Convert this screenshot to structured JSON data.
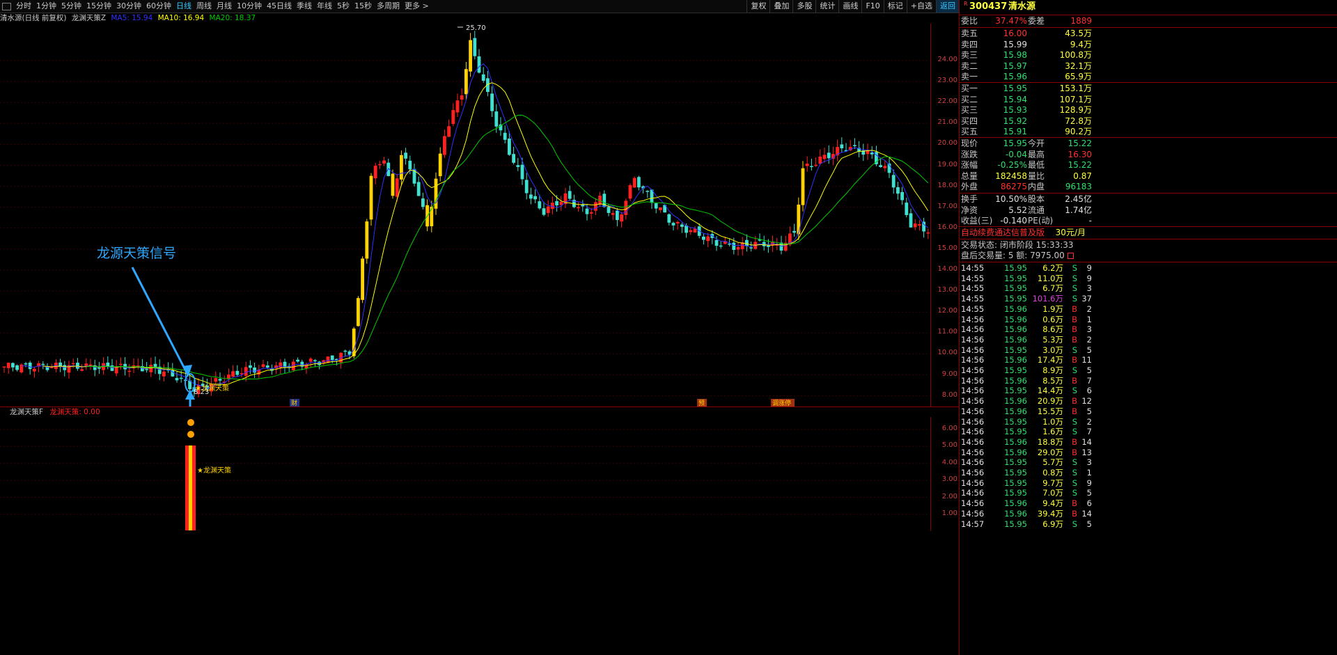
{
  "toolbar": {
    "periods": [
      "分时",
      "1分钟",
      "5分钟",
      "15分钟",
      "30分钟",
      "60分钟",
      "日线",
      "周线",
      "月线",
      "10分钟",
      "45日线",
      "季线",
      "年线",
      "5秒",
      "15秒",
      "多周期",
      "更多 >"
    ],
    "active_period": "日线",
    "tools": [
      "复权",
      "叠加",
      "多股",
      "统计",
      "画线",
      "F10",
      "标记",
      "+自选",
      "返回"
    ]
  },
  "main_title": {
    "stock": "清水源(日线 前复权)",
    "indicator": "龙渊天策Z",
    "ma5": "MA5: 15.94",
    "ma10": "MA10: 16.94",
    "ma20": "MA20: 18.37"
  },
  "colors": {
    "up": "#ff2020",
    "down": "#40e0d0",
    "ma5": "#3030ff",
    "ma10": "#ffff00",
    "ma20": "#00cc00",
    "signal": "#ffd200",
    "annotation": "#2ea8ff"
  },
  "annotation": {
    "text": "龙源天策信号"
  },
  "chart_labels": {
    "high": "25.70",
    "low": "8.23",
    "signal": "★龙渊天策",
    "events": [
      {
        "text": "财"
      },
      {
        "text": "预"
      },
      {
        "text": "调涨停"
      }
    ]
  },
  "axis_main": [
    "24.00",
    "23.00",
    "22.00",
    "21.00",
    "20.00",
    "19.00",
    "18.00",
    "17.00",
    "16.00",
    "15.00",
    "14.00",
    "13.00",
    "12.00",
    "11.00",
    "10.00",
    "9.00",
    "8.00"
  ],
  "axis_sub": [
    "6.00",
    "5.00",
    "4.00",
    "3.00",
    "2.00",
    "1.00"
  ],
  "sub_title": {
    "name": "龙渊天策F",
    "value": "龙渊天策: 0.00",
    "signal_label": "★龙渊天策"
  },
  "quote": {
    "code": "300437",
    "name": "清水源",
    "tag": "R",
    "weibi_label": "委比",
    "weibi": "37.47%",
    "weicha_label": "委差",
    "weicha": "1889",
    "asks": [
      {
        "label": "卖五",
        "price": "16.00",
        "vol": "43.5万"
      },
      {
        "label": "卖四",
        "price": "15.99",
        "vol": "9.4万"
      },
      {
        "label": "卖三",
        "price": "15.98",
        "vol": "100.8万"
      },
      {
        "label": "卖二",
        "price": "15.97",
        "vol": "32.1万"
      },
      {
        "label": "卖一",
        "price": "15.96",
        "vol": "65.9万"
      }
    ],
    "bids": [
      {
        "label": "买一",
        "price": "15.95",
        "vol": "153.1万"
      },
      {
        "label": "买二",
        "price": "15.94",
        "vol": "107.1万"
      },
      {
        "label": "买三",
        "price": "15.93",
        "vol": "128.9万"
      },
      {
        "label": "买四",
        "price": "15.92",
        "vol": "72.8万"
      },
      {
        "label": "买五",
        "price": "15.91",
        "vol": "90.2万"
      }
    ],
    "stats": [
      {
        "l1": "现价",
        "v1": "15.95",
        "l2": "今开",
        "v2": "15.22"
      },
      {
        "l1": "涨跌",
        "v1": "-0.04",
        "l2": "最高",
        "v2": "16.30"
      },
      {
        "l1": "涨幅",
        "v1": "-0.25%",
        "l2": "最低",
        "v2": "15.22"
      },
      {
        "l1": "总量",
        "v1": "182458",
        "l2": "量比",
        "v2": "0.87"
      },
      {
        "l1": "外盘",
        "v1": "86275",
        "l2": "内盘",
        "v2": "96183"
      }
    ],
    "stats2": [
      {
        "l1": "换手",
        "v1": "10.50%",
        "l2": "股本",
        "v2": "2.45亿"
      },
      {
        "l1": "净资",
        "v1": "5.52",
        "l2": "流通",
        "v2": "1.74亿"
      },
      {
        "l1": "收益(三)",
        "v1": "-0.140",
        "l2": "PE(动)",
        "v2": "-"
      }
    ],
    "promo": "自动续费通达信普及版",
    "promo_price": "30元/月",
    "trade_state": "交易状态: 闭市阶段 15:33:33",
    "after_hours": "盘后交易量: 5  额: 7975.00",
    "ticks": [
      {
        "t": "14:55",
        "p": "15.95",
        "v": "6.2万",
        "d": "S",
        "n": "9"
      },
      {
        "t": "14:55",
        "p": "15.95",
        "v": "11.0万",
        "d": "S",
        "n": "9"
      },
      {
        "t": "14:55",
        "p": "15.95",
        "v": "6.7万",
        "d": "S",
        "n": "3"
      },
      {
        "t": "14:55",
        "p": "15.95",
        "v": "101.6万",
        "d": "S",
        "n": "37"
      },
      {
        "t": "14:55",
        "p": "15.96",
        "v": "1.9万",
        "d": "B",
        "n": "2"
      },
      {
        "t": "14:56",
        "p": "15.96",
        "v": "0.6万",
        "d": "B",
        "n": "1"
      },
      {
        "t": "14:56",
        "p": "15.96",
        "v": "8.6万",
        "d": "B",
        "n": "3"
      },
      {
        "t": "14:56",
        "p": "15.96",
        "v": "5.3万",
        "d": "B",
        "n": "2"
      },
      {
        "t": "14:56",
        "p": "15.95",
        "v": "3.0万",
        "d": "S",
        "n": "5"
      },
      {
        "t": "14:56",
        "p": "15.96",
        "v": "17.4万",
        "d": "B",
        "n": "11"
      },
      {
        "t": "14:56",
        "p": "15.95",
        "v": "8.9万",
        "d": "S",
        "n": "5"
      },
      {
        "t": "14:56",
        "p": "15.96",
        "v": "8.5万",
        "d": "B",
        "n": "7"
      },
      {
        "t": "14:56",
        "p": "15.95",
        "v": "14.4万",
        "d": "S",
        "n": "6"
      },
      {
        "t": "14:56",
        "p": "15.96",
        "v": "20.9万",
        "d": "B",
        "n": "12"
      },
      {
        "t": "14:56",
        "p": "15.96",
        "v": "15.5万",
        "d": "B",
        "n": "5"
      },
      {
        "t": "14:56",
        "p": "15.95",
        "v": "1.0万",
        "d": "S",
        "n": "2"
      },
      {
        "t": "14:56",
        "p": "15.95",
        "v": "1.6万",
        "d": "S",
        "n": "7"
      },
      {
        "t": "14:56",
        "p": "15.96",
        "v": "18.8万",
        "d": "B",
        "n": "14"
      },
      {
        "t": "14:56",
        "p": "15.96",
        "v": "29.0万",
        "d": "B",
        "n": "13"
      },
      {
        "t": "14:56",
        "p": "15.95",
        "v": "5.7万",
        "d": "S",
        "n": "3"
      },
      {
        "t": "14:56",
        "p": "15.95",
        "v": "0.8万",
        "d": "S",
        "n": "1"
      },
      {
        "t": "14:56",
        "p": "15.95",
        "v": "9.7万",
        "d": "S",
        "n": "9"
      },
      {
        "t": "14:56",
        "p": "15.95",
        "v": "7.0万",
        "d": "S",
        "n": "5"
      },
      {
        "t": "14:56",
        "p": "15.96",
        "v": "9.4万",
        "d": "B",
        "n": "6"
      },
      {
        "t": "14:56",
        "p": "15.96",
        "v": "39.4万",
        "d": "B",
        "n": "14"
      },
      {
        "t": "14:57",
        "p": "15.95",
        "v": "6.9万",
        "d": "S",
        "n": "5"
      }
    ]
  }
}
